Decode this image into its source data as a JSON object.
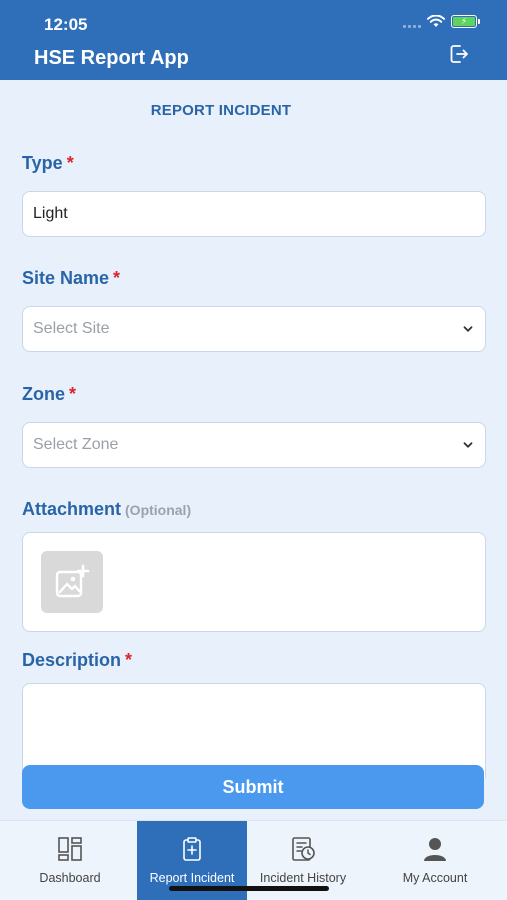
{
  "status": {
    "time": "12:05"
  },
  "header": {
    "title": "HSE Report App"
  },
  "form": {
    "section_title": "REPORT INCIDENT",
    "type": {
      "label": "Type",
      "required": "*",
      "value": "Light"
    },
    "site": {
      "label": "Site Name",
      "required": "*",
      "placeholder": "Select Site"
    },
    "zone": {
      "label": "Zone",
      "required": "*",
      "placeholder": "Select Zone"
    },
    "attachment": {
      "label": "Attachment",
      "optional": "(Optional)"
    },
    "description": {
      "label": "Description",
      "required": "*"
    },
    "submit_label": "Submit"
  },
  "tabs": [
    {
      "label": "Dashboard",
      "icon": "dashboard-icon",
      "active": false
    },
    {
      "label": "Report Incident",
      "icon": "clipboard-plus-icon",
      "active": true
    },
    {
      "label": "Incident History",
      "icon": "history-icon",
      "active": false
    },
    {
      "label": "My Account",
      "icon": "user-icon",
      "active": false
    }
  ],
  "colors": {
    "header": "#2f6fba",
    "accent": "#2a64a8",
    "submit": "#4a99ee",
    "required": "#d8262a",
    "background": "#e8f1fb"
  }
}
